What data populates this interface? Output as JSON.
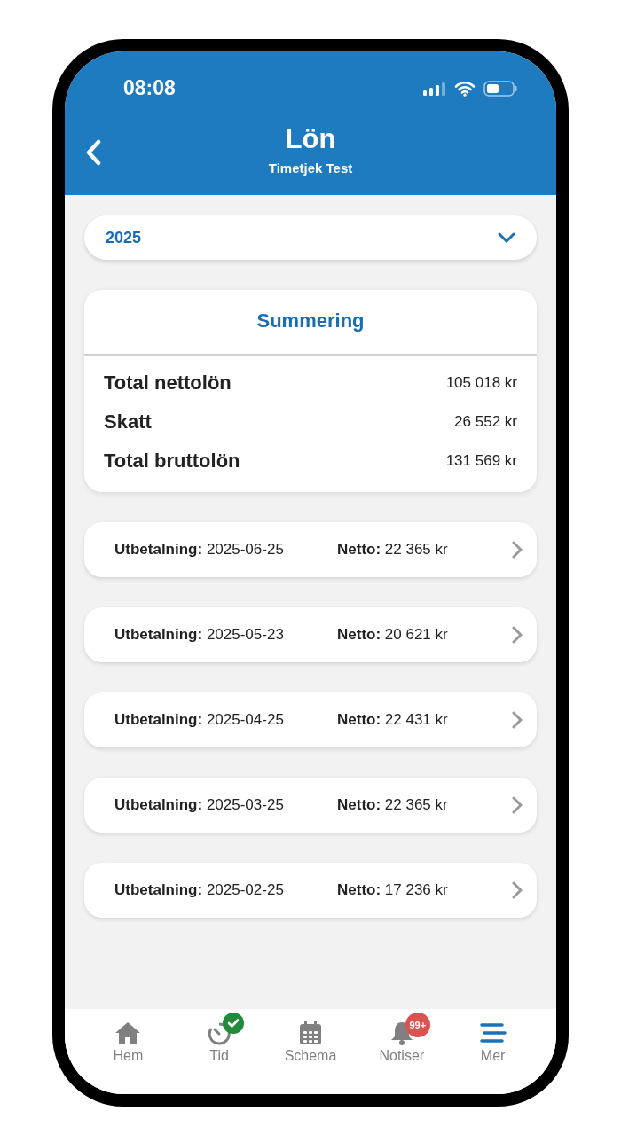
{
  "status_bar": {
    "time": "08:08"
  },
  "header": {
    "title": "Lön",
    "subtitle": "Timetjek Test"
  },
  "year_select": {
    "value": "2025"
  },
  "summary": {
    "title": "Summering",
    "rows": [
      {
        "label": "Total nettolön",
        "value": "105 018 kr"
      },
      {
        "label": "Skatt",
        "value": "26 552 kr"
      },
      {
        "label": "Total bruttolön",
        "value": "131 569 kr"
      }
    ]
  },
  "payments": [
    {
      "payout": "**Utbetalning:** 2025-06-25",
      "net": "**Netto:** 22 365 kr"
    },
    {
      "payout": "**Utbetalning:** 2025-05-23",
      "net": "**Netto:** 20 621 kr"
    },
    {
      "payout": "**Utbetalning:** 2025-04-25",
      "net": "**Netto:** 22 431 kr"
    },
    {
      "payout": "**Utbetalning:** 2025-03-25",
      "net": "**Netto:** 22 365 kr"
    },
    {
      "payout": "**Utbetalning:** 2025-02-25",
      "net": "**Netto:** 17 236 kr"
    }
  ],
  "tab_bar": [
    {
      "kind": "home",
      "label": "Hem",
      "selected": false,
      "checked": false
    },
    {
      "kind": "timer",
      "label": "Tid",
      "selected": false,
      "checked": true
    },
    {
      "kind": "calendar",
      "label": "Schema",
      "selected": false,
      "checked": false
    },
    {
      "kind": "bell",
      "label": "Notiser",
      "selected": false,
      "checked": false,
      "badge": "99+"
    },
    {
      "kind": "menu",
      "label": "Mer",
      "selected": true,
      "checked": false
    }
  ]
}
